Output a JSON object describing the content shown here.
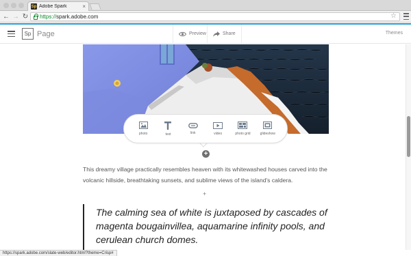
{
  "browser": {
    "tab_title": "Adobe Spark",
    "tab_favicon_text": "Sp",
    "tab_close": "×",
    "url_scheme": "https://",
    "url_host": "spark.adobe.com",
    "status_url": "https://spark.adobe.com/slate-web/editor.html?theme=Crisp#"
  },
  "app": {
    "logo_text": "Sp",
    "product_name": "Page",
    "preview_label": "Preview",
    "share_label": "Share",
    "themes_label": "Themes"
  },
  "insert_menu": {
    "items": [
      {
        "label": "photo",
        "icon": "photo-icon"
      },
      {
        "label": "text",
        "icon": "text-icon"
      },
      {
        "label": "link",
        "icon": "link-icon"
      },
      {
        "label": "video",
        "icon": "video-icon"
      },
      {
        "label": "photo grid",
        "icon": "photo-grid-icon"
      },
      {
        "label": "glideshow",
        "icon": "glideshow-icon"
      }
    ]
  },
  "content": {
    "body_text": "This dreamy village practically resembles heaven with its whitewashed houses carved into the volcanic hillside, breathtaking sunsets, and sublime views of the island's caldera.",
    "quote_text": "The calming sea of white is juxtaposed by cascades of magenta bougainvillea, aquamarine infinity pools, and cerulean church domes.",
    "add_symbol": "+"
  },
  "colors": {
    "accent": "#1e9ed8",
    "secure_green": "#0c8a2a",
    "sea": "#1d2a3a",
    "wall_blue": "#7f8fe0"
  }
}
